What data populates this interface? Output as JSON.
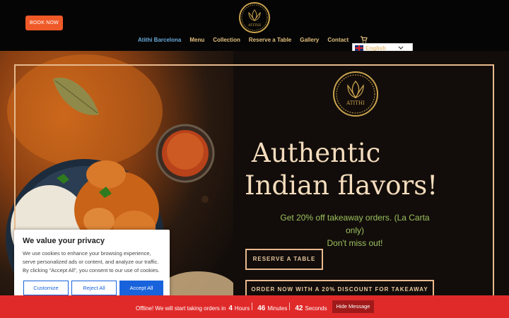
{
  "header": {
    "book_label": "BOOK NOW",
    "nav": [
      "Atithi Barcelona",
      "Menu",
      "Collection",
      "Reserve a Table",
      "Gallery",
      "Contact"
    ],
    "language": "English"
  },
  "hero": {
    "headline_1": "Authentic",
    "headline_2": "Indian flavors!",
    "promo_1": "Get 20% off takeaway orders. (La Carta only)",
    "promo_2": "Don't miss out!",
    "reserve_label": "RESERVE A TABLE",
    "order_label": "ORDER NOW WITH A 20% DISCOUNT FOR TAKEAWAY"
  },
  "cookie": {
    "title": "We value your privacy",
    "text": "We use cookies to enhance your browsing experience, serve personalized ads or content, and analyze our traffic. By clicking \"Accept All\", you consent to our use of cookies.",
    "customize": "Customize",
    "reject": "Reject All",
    "accept": "Accept All"
  },
  "offline": {
    "message": "Offline! We will start taking orders in",
    "hours": "4",
    "hours_label": "Hours",
    "minutes": "46",
    "minutes_label": "Minutes",
    "seconds": "42",
    "seconds_label": "Seconds",
    "hide_label": "Hide Message"
  },
  "colors": {
    "accent": "#f05a28",
    "gold": "#e7b98e",
    "green": "#9cc15e",
    "bar": "#e02a2a",
    "cookie_blue": "#1863dc"
  }
}
